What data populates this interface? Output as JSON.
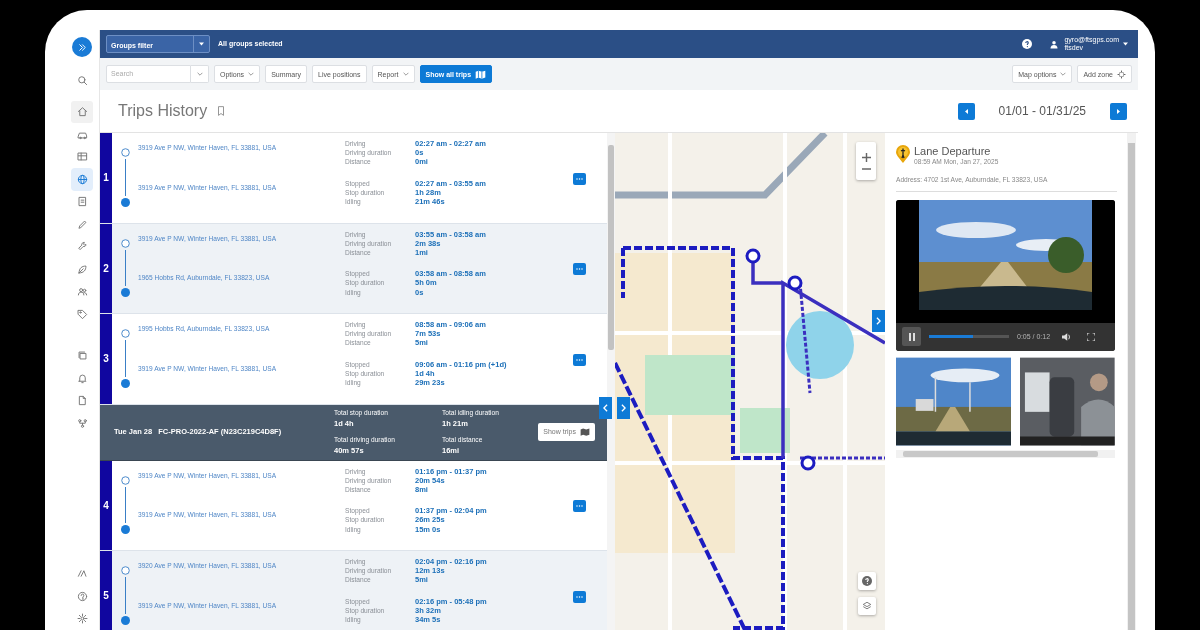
{
  "sidebar": {
    "items": [
      {
        "kind": "expand",
        "selected": false
      },
      {
        "kind": "search",
        "selected": false
      },
      {
        "kind": "home",
        "selected": false
      },
      {
        "kind": "car",
        "selected": false
      },
      {
        "kind": "grid",
        "selected": false
      },
      {
        "kind": "globe",
        "selected": true
      },
      {
        "kind": "document",
        "selected": false
      },
      {
        "kind": "pencil",
        "selected": false
      },
      {
        "kind": "wrench",
        "selected": false
      },
      {
        "kind": "leaf",
        "selected": false
      },
      {
        "kind": "people",
        "selected": false
      },
      {
        "kind": "tag",
        "selected": false
      },
      {
        "kind": "copy",
        "selected": false
      },
      {
        "kind": "bell",
        "selected": false
      },
      {
        "kind": "file",
        "selected": false
      },
      {
        "kind": "network",
        "selected": false
      },
      {
        "kind": "logo",
        "selected": false
      },
      {
        "kind": "help",
        "selected": false
      },
      {
        "kind": "settings",
        "selected": false
      }
    ]
  },
  "top_bar": {
    "groups_filter": {
      "value": "Groups filter"
    },
    "groups_status": "All groups selected",
    "user": {
      "email": "gyro@ftsgps.com",
      "account": "ftsdev"
    }
  },
  "toolbar": {
    "search": {
      "placeholder": "Search"
    },
    "buttons": [
      {
        "label": "Options",
        "kind": "dropdown"
      },
      {
        "label": "Summary",
        "kind": "plain"
      },
      {
        "label": "Live positions",
        "kind": "plain"
      },
      {
        "label": "Report",
        "kind": "dropdown"
      },
      {
        "label": "Show all trips",
        "kind": "primary"
      }
    ],
    "map_buttons": [
      {
        "label": "Map options",
        "kind": "dropdown"
      },
      {
        "label": "Add zone",
        "kind": "zone"
      }
    ]
  },
  "page": {
    "title": "Trips History",
    "date_range": "01/01 - 01/31/25"
  },
  "trips": [
    {
      "kind": "trip",
      "number": "1",
      "from": "3919 Ave P NW, Winter Haven, FL 33881, USA",
      "to": "3919 Ave P NW, Winter Haven, FL 33881, USA",
      "driving": [
        {
          "label": "Driving",
          "value": "02:27 am - 02:27 am"
        },
        {
          "label": "Driving duration",
          "value": "0s"
        },
        {
          "label": "Distance",
          "value": "0mi"
        }
      ],
      "stop": [
        {
          "label": "Stopped",
          "value": "02:27 am - 03:55 am"
        },
        {
          "label": "Stop duration",
          "value": "1h 28m"
        },
        {
          "label": "Idling",
          "value": "21m 46s"
        }
      ]
    },
    {
      "kind": "trip",
      "number": "2",
      "from": "3919 Ave P NW, Winter Haven, FL 33881, USA",
      "to": "1965 Hobbs Rd, Auburndale, FL 33823, USA",
      "driving": [
        {
          "label": "Driving",
          "value": "03:55 am - 03:58 am"
        },
        {
          "label": "Driving duration",
          "value": "2m 38s"
        },
        {
          "label": "Distance",
          "value": "1mi"
        }
      ],
      "stop": [
        {
          "label": "Stopped",
          "value": "03:58 am - 08:58 am"
        },
        {
          "label": "Stop duration",
          "value": "5h 0m"
        },
        {
          "label": "Idling",
          "value": "0s"
        }
      ]
    },
    {
      "kind": "trip",
      "number": "3",
      "from": "1995 Hobbs Rd, Auburndale, FL 33823, USA",
      "to": "3919 Ave P NW, Winter Haven, FL 33881, USA",
      "driving": [
        {
          "label": "Driving",
          "value": "08:58 am - 09:06 am"
        },
        {
          "label": "Driving duration",
          "value": "7m 53s"
        },
        {
          "label": "Distance",
          "value": "5mi"
        }
      ],
      "stop": [
        {
          "label": "Stopped",
          "value": "09:06 am - 01:16 pm (+1d)"
        },
        {
          "label": "Stop duration",
          "value": "1d 4h"
        },
        {
          "label": "Idling",
          "value": "29m 23s"
        }
      ]
    },
    {
      "kind": "day_summary",
      "date": "Tue Jan 28",
      "vehicle": "FC-PRO-2022-AF (N23C219C4D8F)",
      "stats": [
        {
          "label": "Total stop duration",
          "value": "1d 4h"
        },
        {
          "label": "Total idling duration",
          "value": "1h 21m"
        },
        {
          "label": "Total driving duration",
          "value": "40m 57s"
        },
        {
          "label": "Total distance",
          "value": "16mi"
        }
      ],
      "button": "Show trips"
    },
    {
      "kind": "trip",
      "number": "4",
      "from": "3919 Ave P NW, Winter Haven, FL 33881, USA",
      "to": "3919 Ave P NW, Winter Haven, FL 33881, USA",
      "driving": [
        {
          "label": "Driving",
          "value": "01:16 pm - 01:37 pm"
        },
        {
          "label": "Driving duration",
          "value": "20m 54s"
        },
        {
          "label": "Distance",
          "value": "8mi"
        }
      ],
      "stop": [
        {
          "label": "Stopped",
          "value": "01:37 pm - 02:04 pm"
        },
        {
          "label": "Stop duration",
          "value": "26m 25s"
        },
        {
          "label": "Idling",
          "value": "15m 0s"
        }
      ]
    },
    {
      "kind": "trip",
      "number": "5",
      "from": "3920 Ave P NW, Winter Haven, FL 33881, USA",
      "to": "3919 Ave P NW, Winter Haven, FL 33881, USA",
      "driving": [
        {
          "label": "Driving",
          "value": "02:04 pm - 02:16 pm"
        },
        {
          "label": "Driving duration",
          "value": "12m 13s"
        },
        {
          "label": "Distance",
          "value": "5mi"
        }
      ],
      "stop": [
        {
          "label": "Stopped",
          "value": "02:16 pm - 05:48 pm"
        },
        {
          "label": "Stop duration",
          "value": "3h 32m"
        },
        {
          "label": "Idling",
          "value": "34m 5s"
        }
      ]
    }
  ],
  "event_panel": {
    "title": "Lane Departure",
    "time": "08:59 AM Mon, Jan 27, 2025",
    "address": "Address: 4702 1st Ave, Auburndale, FL 33823, USA",
    "video": {
      "playing": true,
      "level": 0.55,
      "time": "0:05 / 0:12"
    }
  }
}
